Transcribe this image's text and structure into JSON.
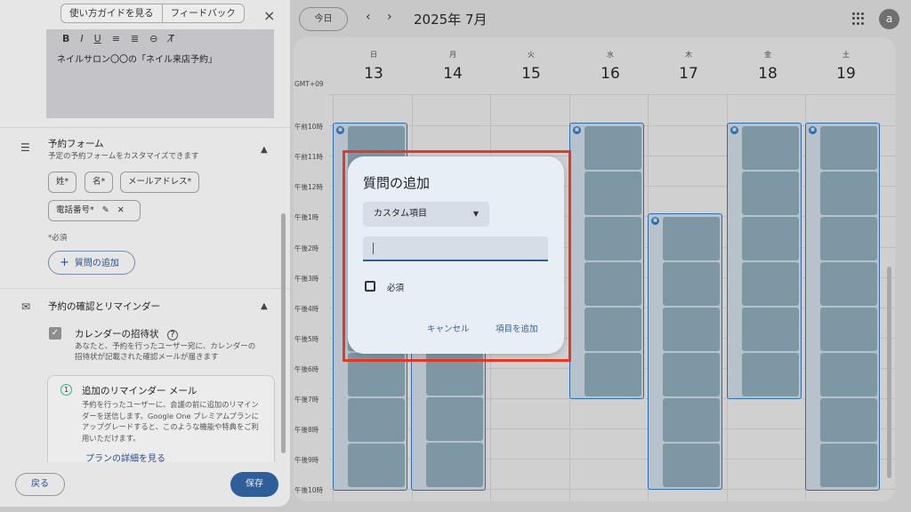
{
  "left_panel": {
    "guide_label": "使い方ガイドを見る",
    "feedback_label": "フィードバック",
    "close_icon": "×",
    "editor": {
      "toolbar": [
        "B",
        "I",
        "U",
        "≡",
        "≣",
        "⊖",
        "T̸"
      ],
      "text": "ネイルサロン〇〇の「ネイル来店予約」"
    },
    "booking_form": {
      "title": "予約フォーム",
      "subtitle": "予定の予約フォームをカスタマイズできます",
      "chips": [
        "姓*",
        "名*",
        "メールアドレス*",
        "電話番号*"
      ],
      "required_note": "*必須",
      "add_question_label": "質問の追加"
    },
    "confirmation": {
      "title": "予約の確認とリマインダー",
      "invite_title": "カレンダーの招待状",
      "invite_desc_1": "あなたと、予約を行ったユーザー宛に、カレンダーの",
      "invite_desc_2": "招待状が記載された確認メールが届きます",
      "reminder": {
        "number": "1",
        "title": "追加のリマインダー メール",
        "body": "予約を行ったユーザーに、会議の前に追加のリマインダーを送信します。Google One プレミアムプランにアップグレードすると、このような機能や特典をご利用いただけます。",
        "link": "プランの詳細を見る"
      }
    },
    "back_label": "戻る",
    "save_label": "保存"
  },
  "calendar": {
    "today_label": "今日",
    "prev_icon": "‹",
    "next_icon": "›",
    "month_title": "2025年 7月",
    "avatar_letter": "a",
    "timezone": "GMT+09",
    "days": [
      {
        "name": "日",
        "date": "13"
      },
      {
        "name": "月",
        "date": "14"
      },
      {
        "name": "火",
        "date": "15"
      },
      {
        "name": "水",
        "date": "16"
      },
      {
        "name": "木",
        "date": "17"
      },
      {
        "name": "金",
        "date": "18"
      },
      {
        "name": "土",
        "date": "19"
      }
    ],
    "times": [
      "午前10時",
      "午前11時",
      "午後12時",
      "午後1時",
      "午後2時",
      "午後3時",
      "午後4時",
      "午後5時",
      "午後6時",
      "午後7時",
      "午後8時",
      "午後9時",
      "午後10時"
    ]
  },
  "dialog": {
    "title": "質問の追加",
    "select_value": "カスタム項目",
    "input_value": "",
    "required_label": "必須",
    "cancel_label": "キャンセル",
    "add_label": "項目を追加"
  }
}
